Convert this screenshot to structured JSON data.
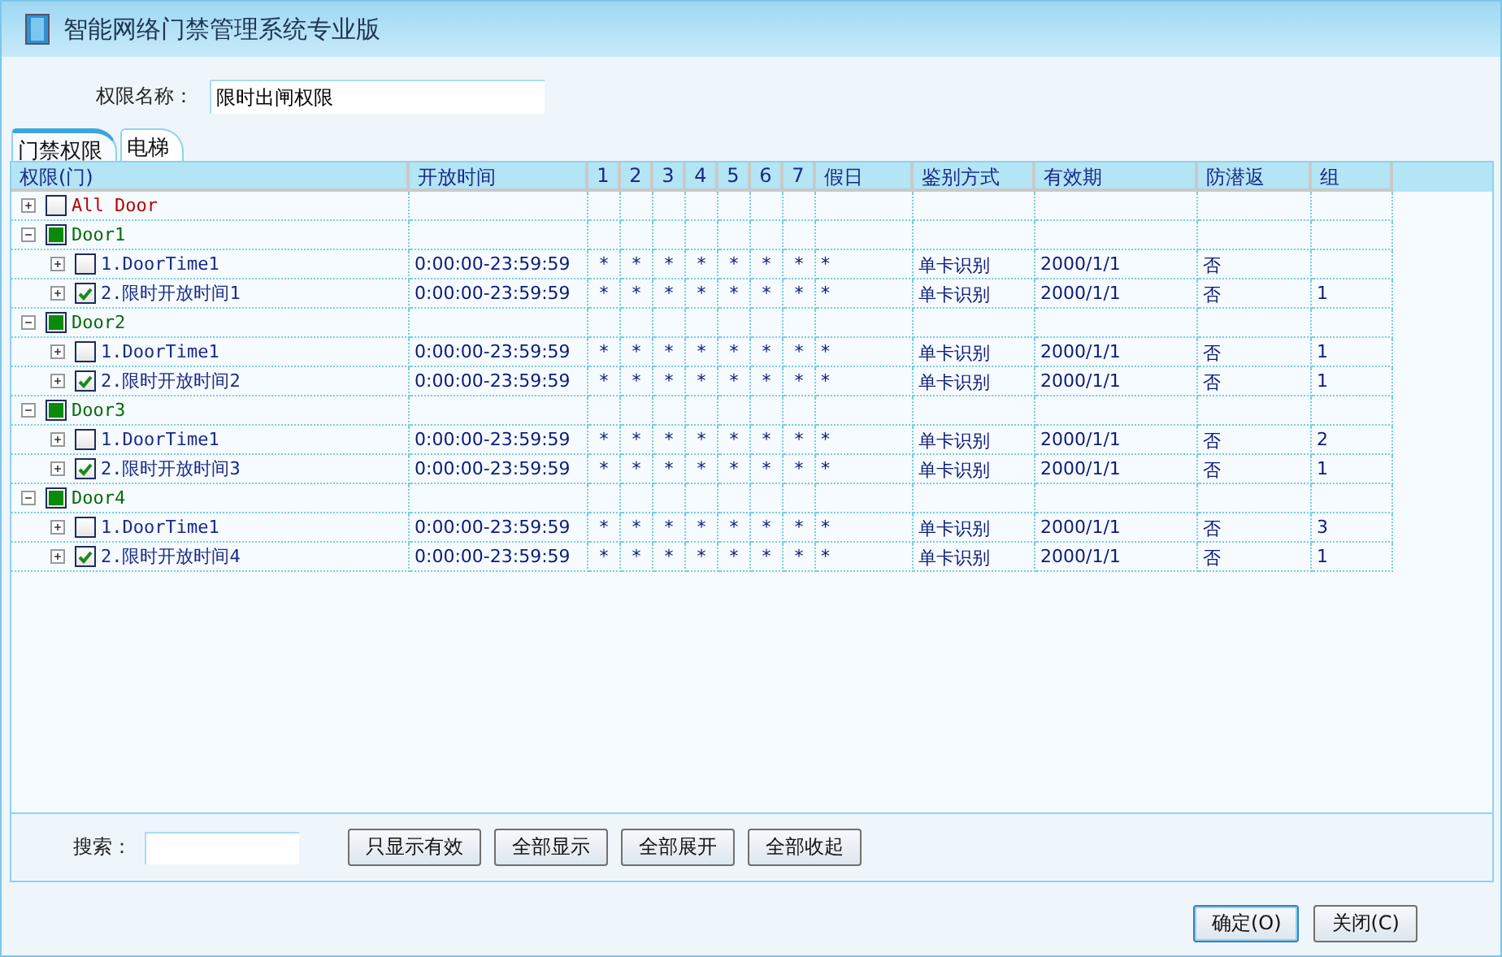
{
  "window": {
    "title": "智能网络门禁管理系统专业版"
  },
  "permission_name": {
    "label": "权限名称：",
    "value": "限时出闸权限"
  },
  "tabs": [
    {
      "label": "门禁权限",
      "selected": true
    },
    {
      "label": "电梯",
      "selected": false
    }
  ],
  "table": {
    "columns": [
      "权限(门)",
      "开放时间",
      "1",
      "2",
      "3",
      "4",
      "5",
      "6",
      "7",
      "假日",
      "鉴别方式",
      "有效期",
      "防潜返",
      "组"
    ],
    "rows": [
      {
        "kind": "all",
        "label": "All Door",
        "expanded": false,
        "checked": false,
        "partial": false
      },
      {
        "kind": "door",
        "label": "Door1",
        "expanded": true,
        "checked": false,
        "partial": true,
        "children": [
          {
            "kind": "time",
            "label": "1.DoorTime1",
            "expanded": false,
            "checked": false,
            "partial": false,
            "cells": {
              "open_time": "0:00:00-23:59:59",
              "days": [
                "*",
                "*",
                "*",
                "*",
                "*",
                "*",
                "*"
              ],
              "holiday": "*",
              "verify": "单卡识别",
              "valid": "2000/1/1",
              "anti_passback": "否"
            }
          },
          {
            "kind": "time",
            "label": "2.限时开放时间1",
            "expanded": false,
            "checked": true,
            "partial": false,
            "cells": {
              "open_time": "0:00:00-23:59:59",
              "days": [
                "*",
                "*",
                "*",
                "*",
                "*",
                "*",
                "*"
              ],
              "holiday": "*",
              "verify": "单卡识别",
              "valid": "2000/1/1",
              "anti_passback": "否",
              "group": "1"
            }
          }
        ]
      },
      {
        "kind": "door",
        "label": "Door2",
        "expanded": true,
        "checked": false,
        "partial": true,
        "children": [
          {
            "kind": "time",
            "label": "1.DoorTime1",
            "expanded": false,
            "checked": false,
            "partial": false,
            "cells": {
              "open_time": "0:00:00-23:59:59",
              "days": [
                "*",
                "*",
                "*",
                "*",
                "*",
                "*",
                "*"
              ],
              "holiday": "*",
              "verify": "单卡识别",
              "valid": "2000/1/1",
              "anti_passback": "否",
              "group": "1"
            }
          },
          {
            "kind": "time",
            "label": "2.限时开放时间2",
            "expanded": false,
            "checked": true,
            "partial": false,
            "cells": {
              "open_time": "0:00:00-23:59:59",
              "days": [
                "*",
                "*",
                "*",
                "*",
                "*",
                "*",
                "*"
              ],
              "holiday": "*",
              "verify": "单卡识别",
              "valid": "2000/1/1",
              "anti_passback": "否",
              "group": "1"
            }
          }
        ]
      },
      {
        "kind": "door",
        "label": "Door3",
        "expanded": true,
        "checked": false,
        "partial": true,
        "children": [
          {
            "kind": "time",
            "label": "1.DoorTime1",
            "expanded": false,
            "checked": false,
            "partial": false,
            "cells": {
              "open_time": "0:00:00-23:59:59",
              "days": [
                "*",
                "*",
                "*",
                "*",
                "*",
                "*",
                "*"
              ],
              "holiday": "*",
              "verify": "单卡识别",
              "valid": "2000/1/1",
              "anti_passback": "否",
              "group": "2"
            }
          },
          {
            "kind": "time",
            "label": "2.限时开放时间3",
            "expanded": false,
            "checked": true,
            "partial": false,
            "cells": {
              "open_time": "0:00:00-23:59:59",
              "days": [
                "*",
                "*",
                "*",
                "*",
                "*",
                "*",
                "*"
              ],
              "holiday": "*",
              "verify": "单卡识别",
              "valid": "2000/1/1",
              "anti_passback": "否",
              "group": "1"
            }
          }
        ]
      },
      {
        "kind": "door",
        "label": "Door4",
        "expanded": true,
        "checked": false,
        "partial": true,
        "children": [
          {
            "kind": "time",
            "label": "1.DoorTime1",
            "expanded": false,
            "checked": false,
            "partial": false,
            "cells": {
              "open_time": "0:00:00-23:59:59",
              "days": [
                "*",
                "*",
                "*",
                "*",
                "*",
                "*",
                "*"
              ],
              "holiday": "*",
              "verify": "单卡识别",
              "valid": "2000/1/1",
              "anti_passback": "否",
              "group": "3"
            }
          },
          {
            "kind": "time",
            "label": "2.限时开放时间4",
            "expanded": false,
            "checked": true,
            "partial": false,
            "cells": {
              "open_time": "0:00:00-23:59:59",
              "days": [
                "*",
                "*",
                "*",
                "*",
                "*",
                "*",
                "*"
              ],
              "holiday": "*",
              "verify": "单卡识别",
              "valid": "2000/1/1",
              "anti_passback": "否",
              "group": "1"
            }
          }
        ]
      }
    ]
  },
  "search": {
    "label": "搜索："
  },
  "filter_buttons": [
    "只显示有效",
    "全部显示",
    "全部展开",
    "全部收起"
  ],
  "dialog_buttons": [
    {
      "label": "确定(O)",
      "default": true
    },
    {
      "label": "关闭(C)",
      "default": false
    }
  ]
}
